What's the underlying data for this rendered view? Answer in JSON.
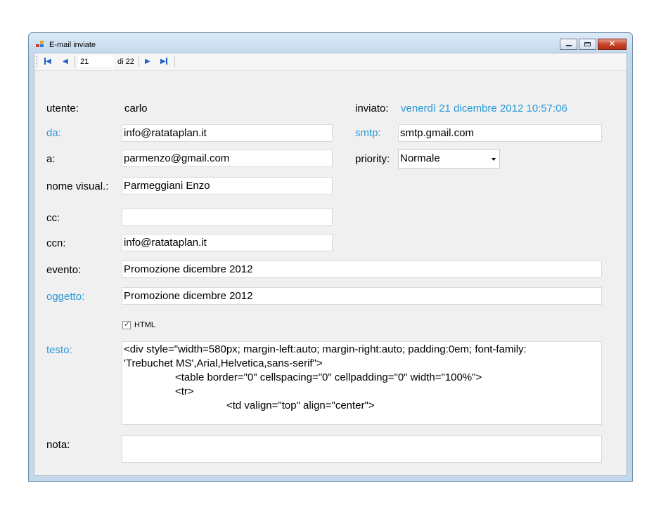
{
  "window": {
    "title": "E-mail inviate"
  },
  "toolbar": {
    "position_value": "21",
    "of_label": "di 22",
    "first_icon": "first-record-icon",
    "prev_icon": "previous-record-icon",
    "next_icon": "next-record-icon",
    "last_icon": "last-record-icon"
  },
  "form": {
    "utente_label": "utente:",
    "utente_value": "carlo",
    "inviato_label": "inviato:",
    "inviato_value": "venerdì 21 dicembre 2012 10:57:06",
    "da_label": "da:",
    "da_value": "info@ratataplan.it",
    "smtp_label": "smtp:",
    "smtp_value": "smtp.gmail.com",
    "a_label": "a:",
    "a_value": "parmenzo@gmail.com",
    "priority_label": "priority:",
    "priority_value": "Normale",
    "nome_label": "nome visual.:",
    "nome_value": "Parmeggiani Enzo",
    "cc_label": "cc:",
    "cc_value": "",
    "ccn_label": "ccn:",
    "ccn_value": "info@ratataplan.it",
    "evento_label": "evento:",
    "evento_value": "Promozione dicembre 2012",
    "oggetto_label": "oggetto:",
    "oggetto_value": "Promozione dicembre 2012",
    "html_label": "HTML",
    "html_checked": true,
    "testo_label": "testo:",
    "testo_lines": [
      "<div style=\"width=580px; margin-left:auto; margin-right:auto; padding:0em; font-family:",
      "'Trebuchet MS',Arial,Helvetica,sans-serif\">",
      "<table border=\"0\" cellspacing=\"0\" cellpadding=\"0\" width=\"100%\">",
      "<tr>",
      "<td valign=\"top\" align=\"center\">"
    ],
    "nota_label": "nota:",
    "nota_value": ""
  },
  "colors": {
    "accent_label": "#2a98d8",
    "nav_icon": "#1f5fc9",
    "close_button": "#c84027"
  }
}
